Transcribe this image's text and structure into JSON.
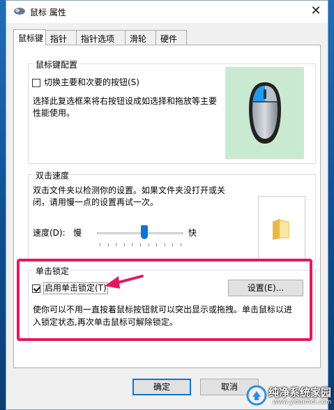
{
  "window": {
    "title": "鼠标 属性",
    "close_glyph": "✕"
  },
  "tabs": [
    {
      "label": "鼠标键",
      "active": true
    },
    {
      "label": "指针",
      "active": false
    },
    {
      "label": "指针选项",
      "active": false
    },
    {
      "label": "滑轮",
      "active": false
    },
    {
      "label": "硬件",
      "active": false
    }
  ],
  "button_config": {
    "legend": "鼠标键配置",
    "swap_label": "切换主要和次要的按钮(S)",
    "swap_checked": false,
    "description_line1": "选择此复选框来将右按钮设成如选择和拖放等主要",
    "description_line2": "性能使用。"
  },
  "double_click": {
    "legend": "双击速度",
    "description_line1": "双击文件夹以检测你的设置。如果文件夹没打开或关",
    "description_line2": "闭，请用慢一点的设置再试一次。",
    "speed_label": "速度(D):",
    "slow_label": "慢",
    "fast_label": "快",
    "speed_fraction": 0.55
  },
  "click_lock": {
    "legend": "单击锁定",
    "enable_label": "启用单击锁定(T)",
    "enable_checked": true,
    "settings_button": "设置(E)...",
    "description_line1": "使你可以不用一直按着鼠标按钮就可以突出显示或拖拽。单击鼠标以进",
    "description_line2": "入锁定状态,再次单击鼠标可解除锁定。"
  },
  "footer": {
    "ok_label": "确定",
    "cancel_label": "取消"
  },
  "watermark": {
    "site_name": "纯净系统家园",
    "site_url": "www.yidaimei.com"
  },
  "colors": {
    "accent_blue": "#0a74da",
    "highlight_pink": "#e5175f",
    "mouse_bg_green": "#c9ead1"
  },
  "icons": [
    "mouse-app-icon",
    "mouse-illustration-icon",
    "folder-icon",
    "pointer-arrow-icon",
    "watermark-logo-icon"
  ]
}
